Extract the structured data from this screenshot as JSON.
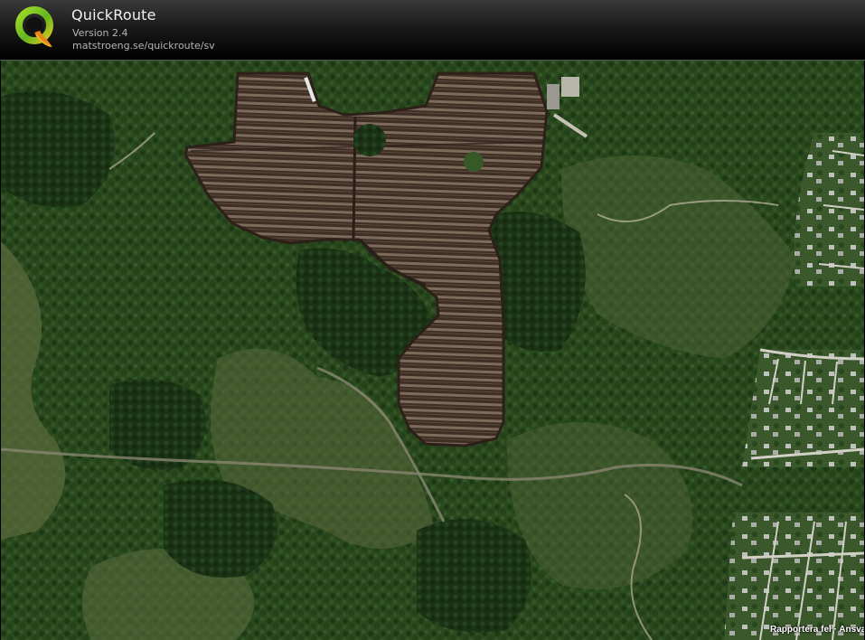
{
  "header": {
    "title": "QuickRoute",
    "version": "Version 2.4",
    "url": "matstroeng.se/quickroute/sv"
  },
  "logo": {
    "letter": "Q",
    "colors": {
      "ring_outer": "#7cc424",
      "ring_inner": "#e0d020",
      "tail": "#e07a10"
    }
  },
  "map": {
    "type": "satellite-imagery",
    "attribution": "Rapportera fel · Ansvar"
  },
  "colors": {
    "forest_dark": "#1f3a17",
    "forest_mid": "#2f4f22",
    "meadow": "#5d6b40",
    "bog_brown": "#4a3a2c",
    "bog_stripe": "#8a7a66",
    "road": "#c9c7bd"
  }
}
